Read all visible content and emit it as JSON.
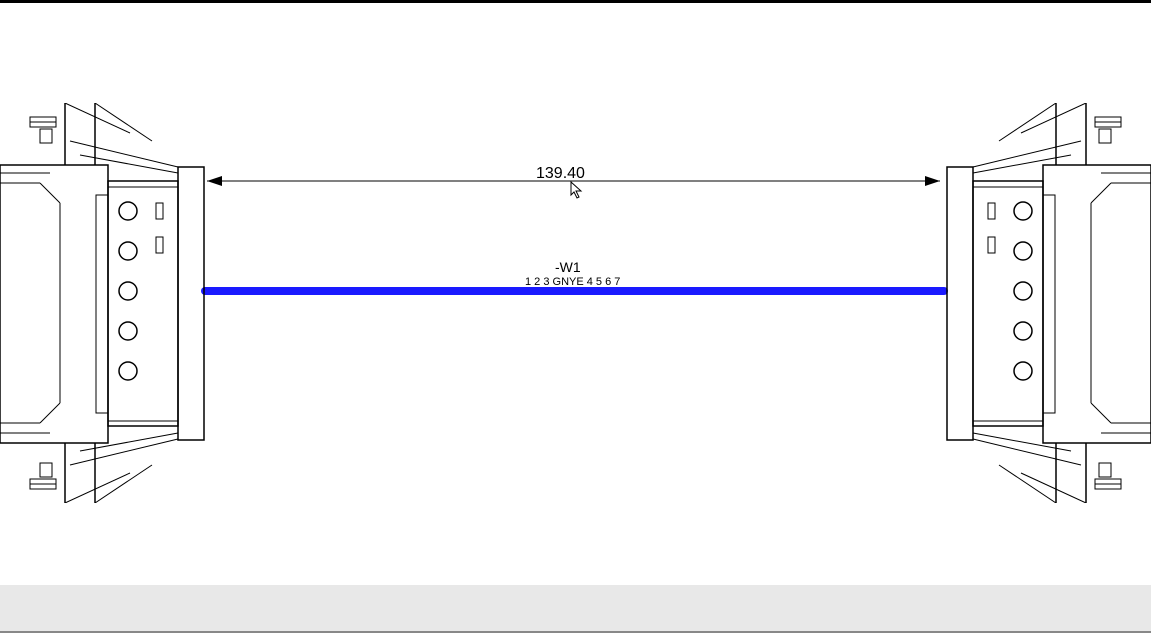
{
  "dimension": {
    "value": "139.40"
  },
  "wire": {
    "name": "-W1",
    "cores": "1 2 3 GNYE 4 5 6 7"
  },
  "connectors": {
    "left": {
      "pins": 5
    },
    "right": {
      "pins": 5
    }
  },
  "colors": {
    "cable": "#1a1aff",
    "outline": "#000"
  }
}
